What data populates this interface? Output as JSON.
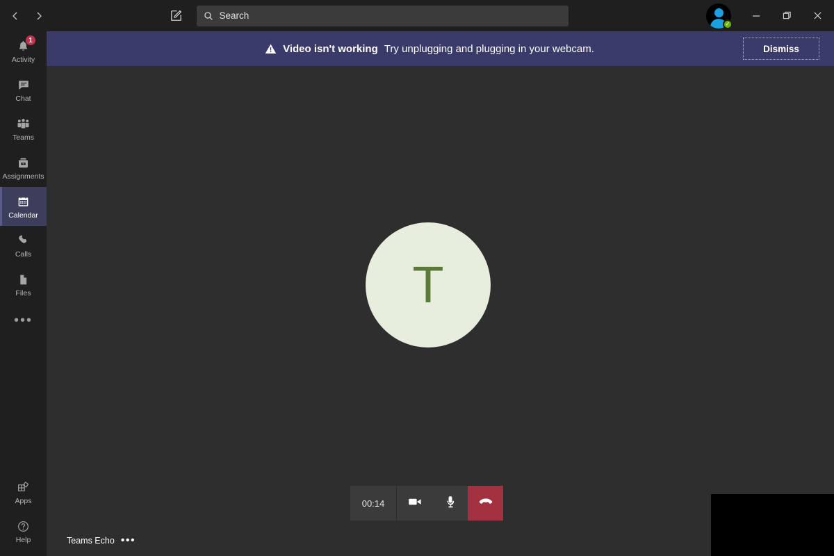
{
  "titlebar": {
    "back_icon": "chevron-left-icon",
    "forward_icon": "chevron-right-icon",
    "compose_icon": "compose-message-icon",
    "search": {
      "icon": "search-icon",
      "placeholder": "Search",
      "value": ""
    },
    "avatar": {
      "presence_status": "Available",
      "presence_glyph": "✓",
      "presence_color": "#6bb700"
    },
    "window_controls": {
      "minimize": "−",
      "maximize": "❐",
      "close": "✕"
    }
  },
  "sidebar": {
    "items": [
      {
        "label": "Activity",
        "icon": "bell-icon",
        "badge": "1",
        "active": false
      },
      {
        "label": "Chat",
        "icon": "chat-bubble-icon",
        "badge": "",
        "active": false
      },
      {
        "label": "Teams",
        "icon": "teams-people-icon",
        "badge": "",
        "active": false
      },
      {
        "label": "Assignments",
        "icon": "assignments-backpack-icon",
        "badge": "",
        "active": false
      },
      {
        "label": "Calendar",
        "icon": "calendar-icon",
        "badge": "",
        "active": true
      },
      {
        "label": "Calls",
        "icon": "phone-icon",
        "badge": "",
        "active": false
      },
      {
        "label": "Files",
        "icon": "file-icon",
        "badge": "",
        "active": false
      }
    ],
    "more_label": "•••",
    "bottom_items": [
      {
        "label": "Apps",
        "icon": "apps-grid-icon"
      },
      {
        "label": "Help",
        "icon": "help-question-icon"
      }
    ]
  },
  "banner": {
    "warning_icon": "warning-triangle-icon",
    "title": "Video isn't working",
    "detail": "Try unplugging and plugging in your webcam.",
    "dismiss_label": "Dismiss",
    "background_color": "#3b3b6b"
  },
  "call": {
    "participant_initial": "T",
    "avatar_background": "#e7eedd",
    "avatar_text_color": "#5b7a3a",
    "caller_name": "Teams Echo",
    "caller_more_label": "•••",
    "self_view_state": "black",
    "controls": {
      "timer": "00:14",
      "camera_icon": "video-camera-icon",
      "mic_icon": "microphone-icon",
      "hangup_icon": "hangup-phone-icon",
      "hangup_color": "#a4313f"
    }
  }
}
